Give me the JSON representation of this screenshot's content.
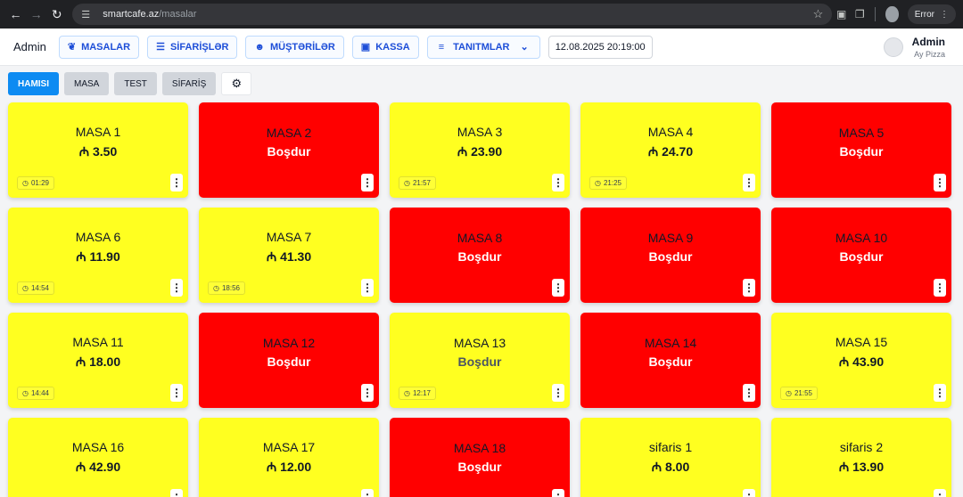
{
  "browser": {
    "url_host": "smartcafe.az",
    "url_path": "/masalar",
    "error_label": "Error"
  },
  "header": {
    "brand": "Admin",
    "nav": [
      {
        "label": "MASALAR",
        "icon": "utensils-icon"
      },
      {
        "label": "SİFARİŞLƏR",
        "icon": "burger-icon"
      },
      {
        "label": "MÜŞTƏRİLƏR",
        "icon": "user-icon"
      },
      {
        "label": "KASSA",
        "icon": "wallet-icon"
      },
      {
        "label": "TANITMLAR",
        "icon": "menu-icon"
      }
    ],
    "datetime": "12.08.2025 20:19:00",
    "user_name": "Admin",
    "cafe_name": "Ay Pizza"
  },
  "filters": [
    {
      "label": "HAMISI",
      "active": true
    },
    {
      "label": "MASA",
      "active": false
    },
    {
      "label": "TEST",
      "active": false
    },
    {
      "label": "SİFARİŞ",
      "active": false
    }
  ],
  "currency_symbol": "₼",
  "empty_label": "Boşdur",
  "colors": {
    "busy": "#ffff20",
    "free": "#ff0000",
    "accent": "#0d8bf2"
  },
  "tables": [
    {
      "name": "MASA 1",
      "status": "busy",
      "amount": "₼ 3.50",
      "time": "01:29"
    },
    {
      "name": "MASA 2",
      "status": "free",
      "amount": "Boşdur",
      "time": ""
    },
    {
      "name": "MASA 3",
      "status": "busy",
      "amount": "₼ 23.90",
      "time": "21:57"
    },
    {
      "name": "MASA 4",
      "status": "busy",
      "amount": "₼ 24.70",
      "time": "21:25"
    },
    {
      "name": "MASA 5",
      "status": "free",
      "amount": "Boşdur",
      "time": ""
    },
    {
      "name": "MASA 6",
      "status": "busy",
      "amount": "₼ 11.90",
      "time": "14:54"
    },
    {
      "name": "MASA 7",
      "status": "busy",
      "amount": "₼ 41.30",
      "time": "18:56"
    },
    {
      "name": "MASA 8",
      "status": "free",
      "amount": "Boşdur",
      "time": ""
    },
    {
      "name": "MASA 9",
      "status": "free",
      "amount": "Boşdur",
      "time": ""
    },
    {
      "name": "MASA 10",
      "status": "free",
      "amount": "Boşdur",
      "time": ""
    },
    {
      "name": "MASA 11",
      "status": "busy",
      "amount": "₼ 18.00",
      "time": "14:44"
    },
    {
      "name": "MASA 12",
      "status": "free",
      "amount": "Boşdur",
      "time": ""
    },
    {
      "name": "MASA 13",
      "status": "busy-empty",
      "amount": "Boşdur",
      "time": "12:17"
    },
    {
      "name": "MASA 14",
      "status": "free",
      "amount": "Boşdur",
      "time": ""
    },
    {
      "name": "MASA 15",
      "status": "busy",
      "amount": "₼ 43.90",
      "time": "21:55"
    },
    {
      "name": "MASA 16",
      "status": "busy",
      "amount": "₼ 42.90",
      "time": ""
    },
    {
      "name": "MASA 17",
      "status": "busy",
      "amount": "₼ 12.00",
      "time": ""
    },
    {
      "name": "MASA 18",
      "status": "free",
      "amount": "Boşdur",
      "time": ""
    },
    {
      "name": "sifaris 1",
      "status": "busy",
      "amount": "₼ 8.00",
      "time": ""
    },
    {
      "name": "sifaris 2",
      "status": "busy",
      "amount": "₼ 13.90",
      "time": ""
    }
  ]
}
